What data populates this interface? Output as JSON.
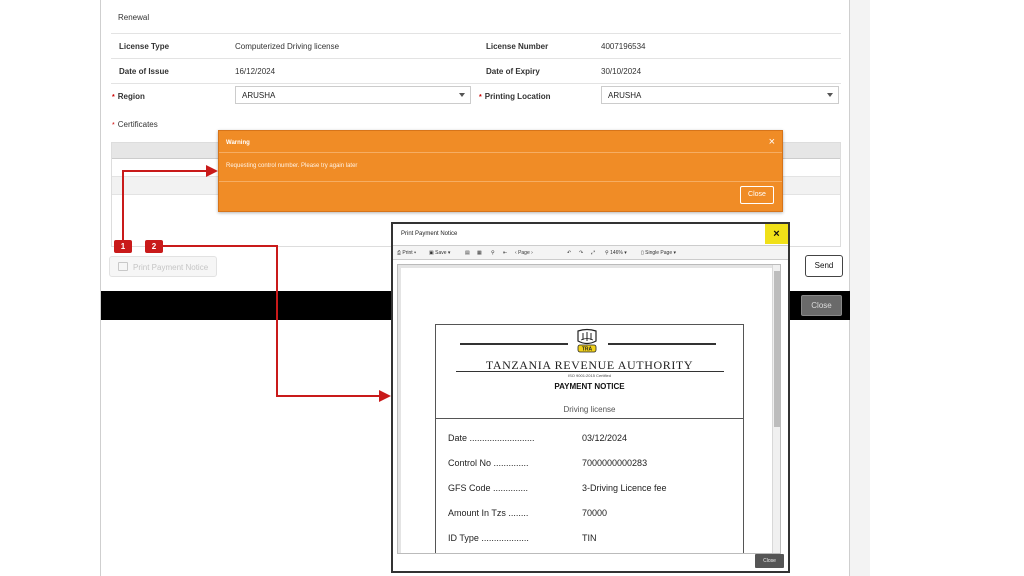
{
  "form": {
    "section_renewal": "Renewal",
    "license_type_label": "License Type",
    "license_type_value": "Computerized Driving license",
    "license_number_label": "License Number",
    "license_number_value": "4007196534",
    "date_of_issue_label": "Date of Issue",
    "date_of_issue_value": "16/12/2024",
    "date_of_expiry_label": "Date of Expiry",
    "date_of_expiry_value": "30/10/2024",
    "region_label": "Region",
    "region_value": "ARUSHA",
    "printing_location_label": "Printing Location",
    "printing_location_value": "ARUSHA",
    "required_mark": "*",
    "section_certificates": "Certificates",
    "print_payment_notice_label": "Print Payment Notice",
    "send_label": "Send",
    "footer_close_label": "Close"
  },
  "warning": {
    "title": "Warning",
    "close_glyph": "×",
    "message": "Requesting control number. Please try again later",
    "button_label": "Close",
    "color": "#f08c26"
  },
  "callouts": {
    "badge_1": "1",
    "badge_2": "2",
    "color": "#c91a1a"
  },
  "print_dialog": {
    "title": "Print Payment Notice",
    "close_glyph": "×",
    "toolbar": {
      "print": "Print",
      "save": "Save",
      "page": "Page",
      "zoom": "146%",
      "view": "Single Page"
    },
    "close_label": "Close",
    "document": {
      "logo_text": "TRA",
      "authority": "TANZANIA REVENUE AUTHORITY",
      "iso": "ISO 9001:2015 Certified",
      "heading": "PAYMENT NOTICE",
      "subheading": "Driving license",
      "rows": [
        {
          "key": "Date ..........................",
          "value": "03/12/2024"
        },
        {
          "key": "Control No ..............",
          "value": "7000000000283"
        },
        {
          "key": "GFS Code ..............",
          "value": "3-Driving Licence fee"
        },
        {
          "key": "Amount In Tzs ........",
          "value": "70000"
        },
        {
          "key": "ID Type ...................",
          "value": "TIN"
        }
      ]
    }
  }
}
